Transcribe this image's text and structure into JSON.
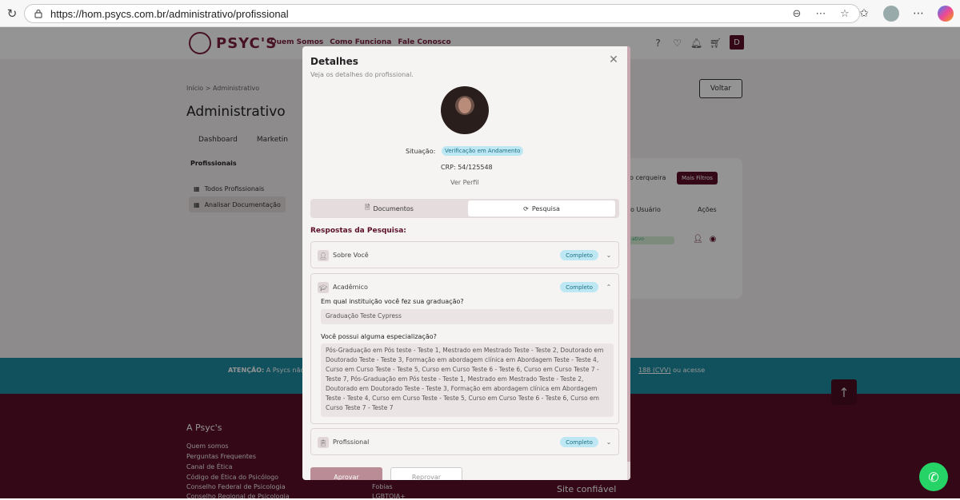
{
  "browser": {
    "url": "https://hom.psycs.com.br/administrativo/profissional"
  },
  "site": {
    "brand": "PSYC'S",
    "nav": [
      "Quem Somos",
      "Como Funciona",
      "Fale Conosco"
    ],
    "user_initial": "D"
  },
  "page": {
    "breadcrumb": "Início > Administrativo",
    "title": "Administrativo",
    "voltar": "Voltar",
    "tabs": [
      "Dashboard",
      "Marketin"
    ],
    "sidebar_title": "Profissionais",
    "sidebar_items": [
      "Todos Profissionais",
      "Analisar Documentação"
    ],
    "filter_link": "o cerqueira",
    "mais_filtros": "Mais Filtros",
    "col_usuario": "o Usuário",
    "col_acoes": "Ações",
    "status_partial": "ativo"
  },
  "alert": {
    "prefix": "ATENÇÃO:",
    "text": "A Psycs não",
    "suffix_link": "188 (CVV)",
    "suffix": "ou acesse"
  },
  "footer": {
    "heading": "A Psyc's",
    "links": [
      "Quem somos",
      "Perguntas Frequentes",
      "Canal de Ética",
      "Código de Ética do Psicólogo",
      "Conselho Federal de Psicologia",
      "Conselho Regional de Psicologia"
    ],
    "links2": [
      "Fobias",
      "LGBTQIA+"
    ],
    "site_confiavel": "Site confiável"
  },
  "modal": {
    "title": "Detalhes",
    "subtitle": "Veja os detalhes do profissional.",
    "situacao_label": "Situação:",
    "situacao_value": "Verificação em Andamento",
    "crp": "CRP: 54/125548",
    "ver_perfil": "Ver Perfil",
    "tab_documentos": "Documentos",
    "tab_pesquisa": "Pesquisa",
    "respostas_title": "Respostas da Pesquisa:",
    "sections": [
      {
        "label": "Sobre Você",
        "badge": "Completo"
      },
      {
        "label": "Acadêmico",
        "badge": "Completo"
      },
      {
        "label": "Profissional",
        "badge": "Completo"
      }
    ],
    "q1": "Em qual instituição você fez sua graduação?",
    "a1": "Graduação Teste Cypress",
    "q2": "Você possui alguma especialização?",
    "a2": "Pós-Graduação em Pós teste - Teste 1, Mestrado em Mestrado Teste - Teste 2, Doutorado em Doutorado Teste - Teste 3, Formação em abordagem clínica em Abordagem Teste - Teste 4, Curso em Curso Teste - Teste 5, Curso em Curso Teste 6 - Teste 6, Curso em Curso Teste 7 - Teste 7, Pós-Graduação em Pós teste - Teste 1, Mestrado em Mestrado Teste - Teste 2, Doutorado em Doutorado Teste - Teste 3, Formação em abordagem clínica em Abordagem Teste - Teste 4, Curso em Curso Teste - Teste 5, Curso em Curso Teste 6 - Teste 6, Curso em Curso Teste 7 - Teste 7",
    "aprovar": "Aprovar",
    "reprovar": "Reprovar"
  }
}
